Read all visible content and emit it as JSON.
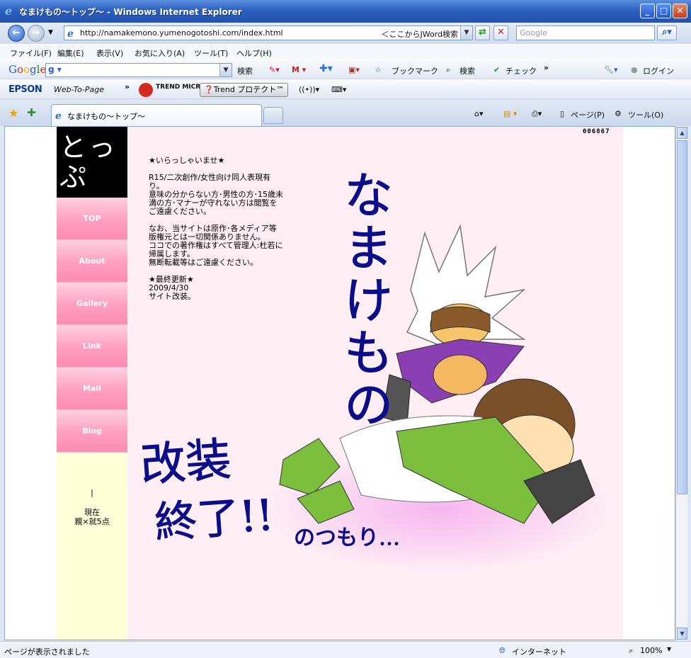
{
  "window": {
    "title": "なまけもの〜トップ〜 - Windows Internet Explorer",
    "minimize": "_",
    "maximize": "□",
    "close": "✕"
  },
  "address_bar": {
    "url": "http://namakemono.yumenogotoshi.com/index.html",
    "jword_hint": "＜ここからJWord検索",
    "search_placeholder": "Google"
  },
  "menu": [
    "ファイル(F)",
    "編集(E)",
    "表示(V)",
    "お気に入り(A)",
    "ツール(T)",
    "ヘルプ(H)"
  ],
  "google_toolbar": {
    "logo": "Google",
    "search_button": "検索",
    "bookmarks": "ブックマーク",
    "search2": "検索",
    "check": "チェック",
    "login": "ログイン"
  },
  "epson_toolbar": {
    "epson": "EPSON",
    "web_to_page": "Web-To-Page",
    "trend_micro": "TREND MICRO",
    "trend_protect": "Trend プロテクト™"
  },
  "tab": {
    "title": "なまけもの〜トップ〜"
  },
  "command_bar": {
    "page": "ページ(P)",
    "tools": "ツール(O)"
  },
  "site": {
    "counter": "006867",
    "logo_text": "とっぷ",
    "nav": [
      "TOP",
      "About",
      "Gallery",
      "Link",
      "Mail",
      "Blog"
    ],
    "side_caret": "|",
    "side_note_1": "現在",
    "side_note_2": "親×就5点",
    "welcome": "★いらっしゃいませ★",
    "notice_1": "R15/二次創作/女性向け同人表現有り。\n意味の分からない方･男性の方･15歳未満の方･マナーが守れない方は閲覧をご遠慮ください。",
    "notice_2": "なお、当サイトは原作･各メディア等版権元とは一切関係ありません。\nココでの著作権はすべて管理人:杜若に帰属します。\n無断転載等はご遠慮ください。",
    "update_heading": "★最終更新★",
    "update_date": "2009/4/30",
    "update_text": "サイト改装。",
    "art_title": "なまけもの",
    "art_scribble_1": "改装",
    "art_scribble_2": "終了!!",
    "art_scribble_3": "のつもり…"
  },
  "status_bar": {
    "text": "ページが表示されました",
    "zone": "インターネット",
    "zoom": "100%"
  }
}
